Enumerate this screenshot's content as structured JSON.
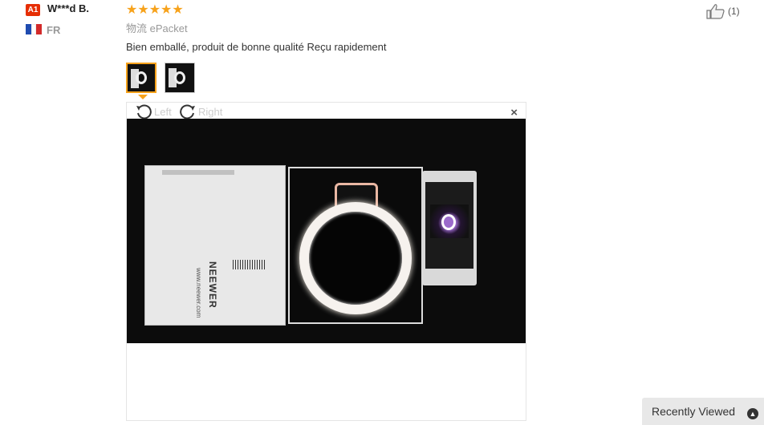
{
  "reviewer": {
    "badge": "A1",
    "name": "W***d B.",
    "country": "FR",
    "flag_colors": [
      "#1f4bb0",
      "#ffffff",
      "#d32a2a"
    ]
  },
  "review": {
    "rating": 5,
    "stars": "★★★★★",
    "shipping": "物流 ePacket",
    "text": "Bien emballé, produit de bonne qualité Reçu rapidement"
  },
  "helpful": {
    "icon": "thumbs-up-icon",
    "count": "(1)"
  },
  "viewer": {
    "rotate_left": "Left",
    "rotate_right": "Right",
    "close": "×"
  },
  "photo_labels": {
    "brand": "NEEWER",
    "url": "www.neewer.com"
  },
  "footer": {
    "recently_viewed": "Recently Viewed",
    "icon": "chevron-up-icon"
  },
  "colors": {
    "accent": "#f7a21b",
    "badge": "#e62e04"
  }
}
